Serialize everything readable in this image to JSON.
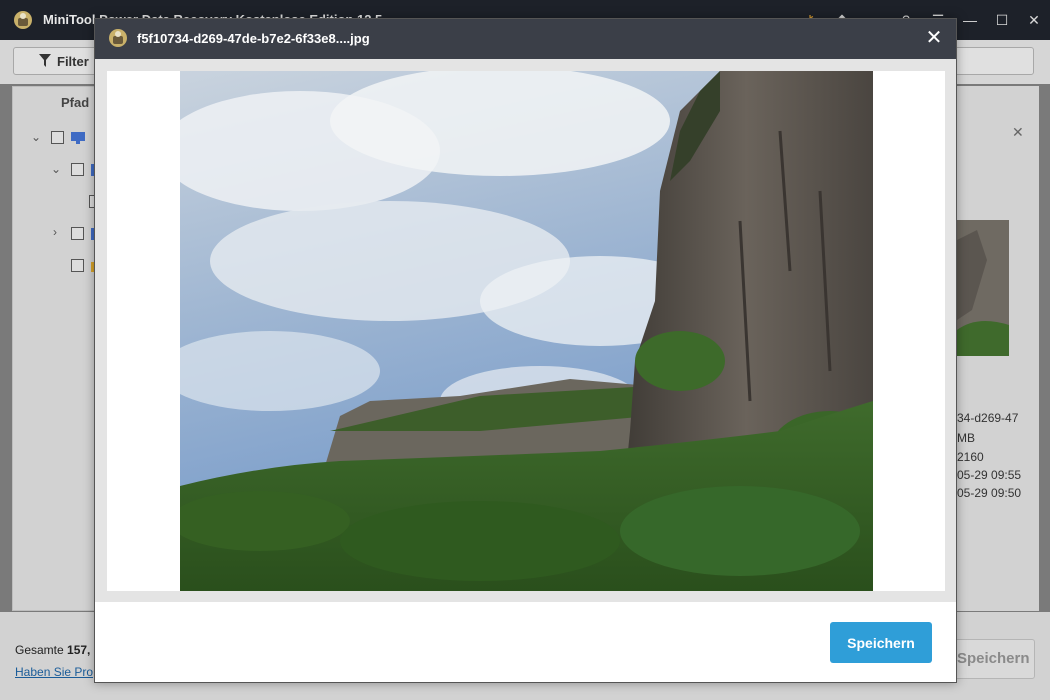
{
  "app": {
    "title": "MiniTool Power Data Recovery Kostenlose Edition 12.5",
    "toolbar": {
      "filter_label": "Filter"
    },
    "left_pane": {
      "path_header": "Pfad"
    },
    "right_pane": {
      "info_lines": [
        "34-d269-47",
        "MB",
        "2160",
        "05-29 09:55",
        "05-29 09:50"
      ]
    },
    "footer": {
      "total_label": "Gesamte",
      "total_value": "157,",
      "help_link": "Haben Sie Pro",
      "save_label": "Speichern"
    }
  },
  "dialog": {
    "file_name": "f5f10734-d269-47de-b7e2-6f33e8....jpg",
    "close_glyph": "✕",
    "save_label": "Speichern",
    "image_description": "Foto: Felswand unter bewölktem Himmel mit grünem Wald"
  },
  "colors": {
    "accent": "#2f9ed8",
    "titlebar": "#1d2129",
    "dialog_title": "#3b3f48"
  },
  "icons": {
    "app_logo": "minitool-logo-icon",
    "filter": "filter-funnel-icon",
    "computer": "computer-icon",
    "drive": "drive-icon",
    "folder": "folder-icon",
    "close": "close-icon"
  }
}
